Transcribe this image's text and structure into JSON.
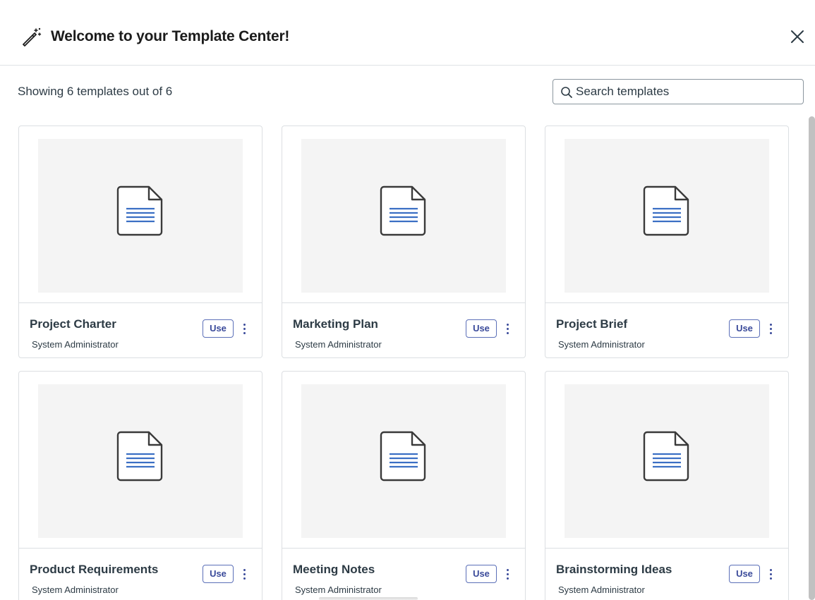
{
  "header": {
    "title": "Welcome to your Template Center!",
    "icon": "magic-wand-icon",
    "close_icon": "close-icon"
  },
  "toolbar": {
    "count_text": "Showing 6 templates out of 6",
    "search_placeholder": "Search templates",
    "search_value": ""
  },
  "templates": [
    {
      "name": "Project Charter",
      "author": "System Administrator",
      "use_label": "Use"
    },
    {
      "name": "Marketing Plan",
      "author": "System Administrator",
      "use_label": "Use"
    },
    {
      "name": "Project Brief",
      "author": "System Administrator",
      "use_label": "Use"
    },
    {
      "name": "Product Requirements",
      "author": "System Administrator",
      "use_label": "Use"
    },
    {
      "name": "Meeting Notes",
      "author": "System Administrator",
      "use_label": "Use"
    },
    {
      "name": "Brainstorming Ideas",
      "author": "System Administrator",
      "use_label": "Use"
    }
  ],
  "colors": {
    "accent": "#3a4a9a",
    "doc_lines": "#3b6fc4",
    "thumb_bg": "#f4f4f4",
    "text": "#2d3b45"
  }
}
